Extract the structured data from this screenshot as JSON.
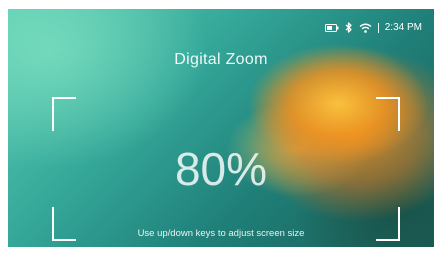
{
  "status_bar": {
    "time": "2:34 PM",
    "battery_icon": "battery-icon",
    "bluetooth_icon": "bluetooth-icon",
    "wifi_icon": "wifi-icon"
  },
  "zoom": {
    "title": "Digital Zoom",
    "value": "80%",
    "hint": "Use up/down keys to adjust screen size"
  },
  "colors": {
    "accent_orange": "#f0a030",
    "background_teal": "#35a89a",
    "text": "#ffffff"
  }
}
